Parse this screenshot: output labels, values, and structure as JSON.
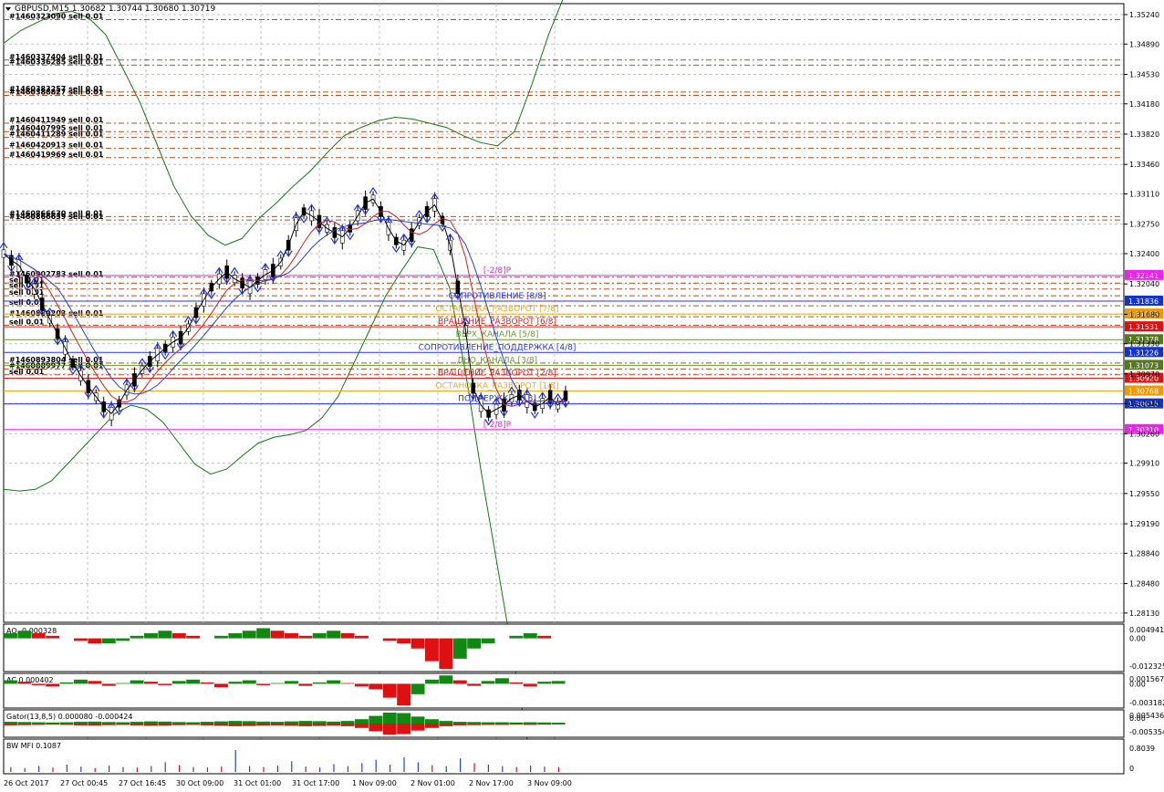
{
  "symbol_header": "GBPUSD,M15  1.30682 1.30744 1.30680 1.30719",
  "colors": {
    "background": "#ffffff",
    "grid": "#c0c0c0",
    "candle": "#000000",
    "envelope": "#117711",
    "arrows": "#2233ee",
    "order_line": "#b05020",
    "bullish": "#118811",
    "bearish": "#dd1111"
  },
  "chart_data": {
    "type": "candlestick",
    "price_ticks": [
      "1.35240",
      "1.34890",
      "1.34530",
      "1.34180",
      "1.33820",
      "1.33460",
      "1.33110",
      "1.32750",
      "1.32400",
      "1.32040",
      "1.31680",
      "1.31330",
      "1.30970",
      "1.30620",
      "1.30260",
      "1.29910",
      "1.29550",
      "1.29190",
      "1.28840",
      "1.28480",
      "1.28130"
    ],
    "time_ticks": [
      "26 Oct 2017",
      "27 Oct 00:45",
      "27 Oct 16:45",
      "30 Oct 09:00",
      "31 Oct 01:00",
      "31 Oct 17:00",
      "1 Nov 09:00",
      "2 Nov 01:00",
      "2 Nov 17:00",
      "3 Nov 09:00"
    ],
    "price_series": [
      1.324,
      1.3232,
      1.3226,
      1.321,
      1.3198,
      1.318,
      1.3162,
      1.3145,
      1.3128,
      1.311,
      1.3095,
      1.3082,
      1.307,
      1.3058,
      1.305,
      1.3062,
      1.3078,
      1.309,
      1.3102,
      1.3112,
      1.312,
      1.3128,
      1.3135,
      1.314,
      1.3152,
      1.317,
      1.3185,
      1.32,
      1.321,
      1.3218,
      1.321,
      1.3205,
      1.32,
      1.3208,
      1.3215,
      1.322,
      1.323,
      1.325,
      1.3275,
      1.329,
      1.3285,
      1.3278,
      1.327,
      1.3265,
      1.326,
      1.327,
      1.3285,
      1.33,
      1.3305,
      1.329,
      1.327,
      1.3255,
      1.325,
      1.3262,
      1.3278,
      1.329,
      1.3298,
      1.328,
      1.325,
      1.32,
      1.315,
      1.308,
      1.306,
      1.305,
      1.3055,
      1.306,
      1.3068,
      1.3072,
      1.3065,
      1.3058,
      1.3062,
      1.307,
      1.306,
      1.3071
    ],
    "envelope_upper": [
      1.349,
      1.3505,
      1.3515,
      1.3525,
      1.3528,
      1.352,
      1.35,
      1.346,
      1.342,
      1.337,
      1.332,
      1.3285,
      1.3262,
      1.325,
      1.3258,
      1.3282,
      1.33,
      1.332,
      1.3338,
      1.336,
      1.338,
      1.339,
      1.3398,
      1.3402,
      1.34,
      1.3395,
      1.339,
      1.338,
      1.3372,
      1.3368,
      1.3385,
      1.344,
      1.35,
      1.355
    ],
    "envelope_lower": [
      1.296,
      1.2958,
      1.296,
      1.297,
      1.299,
      1.301,
      1.303,
      1.305,
      1.306,
      1.3055,
      1.304,
      1.3015,
      1.299,
      1.2978,
      1.2984,
      1.3,
      1.3015,
      1.3022,
      1.3025,
      1.303,
      1.3045,
      1.307,
      1.311,
      1.315,
      1.319,
      1.322,
      1.3248,
      1.3245,
      1.32,
      1.31,
      1.298,
      1.287,
      1.276,
      1.265
    ],
    "murrey_lines": [
      {
        "price": 1.32141,
        "label": "[-2/8]P",
        "tag": "1.32141",
        "color": "#ee22ee",
        "tag_color": "#ee22ee"
      },
      {
        "price": 1.31836,
        "label": "СОПРОТИВЛЕНИЕ [8/8]",
        "tag": "1.31836",
        "color": "#2233ee",
        "tag_color": "#1133cc"
      },
      {
        "price": 1.31683,
        "label": "ОСТАНОВКА_РАЗВОРОТ [7/8]",
        "tag": "1.31683",
        "color": "#eeaa22",
        "tag_color": "#ee9900"
      },
      {
        "price": 1.31531,
        "label": "ВРАЩЕНИЕ_РАЗВОРОТ [6/8]",
        "tag": "1.31531",
        "color": "#dd2222",
        "tag_color": "#dd1111"
      },
      {
        "price": 1.31378,
        "label": "ВЕРХ_КАНАЛА [5/8]",
        "tag": "1.31378",
        "color": "#669933",
        "tag_color": "#557722"
      },
      {
        "price": 1.31226,
        "label": "СОПРОТИВЛЕНИЕ_ПОДДЕРЖКА [4/8]",
        "tag": "1.31226",
        "color": "#2233ee",
        "tag_color": "#1133cc"
      },
      {
        "price": 1.31073,
        "label": "ДНО_КАНАЛА [3/8]",
        "tag": "1.31073",
        "color": "#669933",
        "tag_color": "#557722"
      },
      {
        "price": 1.3092,
        "label": "ВРАЩЕНИЕ_РАЗВОРОТ [2/8]",
        "tag": "1.30920",
        "color": "#dd2222",
        "tag_color": "#dd1111"
      },
      {
        "price": 1.30768,
        "label": "ОСТАНОВКА_РАЗВОРОТ [1/8]",
        "tag": "1.30768",
        "color": "#eeaa22",
        "tag_color": "#ee9900"
      },
      {
        "price": 1.30615,
        "label": "ПОДДЕРЖКА [0/8]",
        "tag": "1.30615",
        "color": "#2233ee",
        "tag_color": "#1133cc"
      },
      {
        "price": 1.3031,
        "label": "[-2/8]P",
        "tag": "1.30310",
        "color": "#ee22ee",
        "tag_color": "#ee22ee"
      }
    ],
    "order_lines": [
      {
        "price": 1.3518,
        "label": "#1460323090 sell 0.01"
      },
      {
        "price": 1.347,
        "label": "#1460337404 sell 0.01"
      },
      {
        "price": 1.3464,
        "label": "#1460336285 sell 0.01"
      },
      {
        "price": 1.3432,
        "label": "#1460383257 sell 0.01"
      },
      {
        "price": 1.3428,
        "label": "#1460388827 sell 0.01"
      },
      {
        "price": 1.3395,
        "label": "#1460411949 sell 0.01"
      },
      {
        "price": 1.3385,
        "label": "#1460407995 sell 0.01"
      },
      {
        "price": 1.3378,
        "label": "#1460411289 sell 0.01"
      },
      {
        "price": 1.3365,
        "label": "#1460420913 sell 0.01"
      },
      {
        "price": 1.3354,
        "label": "#1460419969 sell 0.01"
      },
      {
        "price": 1.3284,
        "label": "#1460866630 sell 0.01"
      },
      {
        "price": 1.328,
        "label": "#1460866639 sell 0.01"
      },
      {
        "price": 1.3212,
        "label": "#1460902783 sell 0.01"
      },
      {
        "price": 1.3205,
        "label": "sell 0.01"
      },
      {
        "price": 1.3198,
        "label": "sell 0.01"
      },
      {
        "price": 1.319,
        "label": "sell 0.01"
      },
      {
        "price": 1.3178,
        "label": "sell 0.01"
      },
      {
        "price": 1.3165,
        "label": "#1460889203 sell 0.01"
      },
      {
        "price": 1.3155,
        "label": "sell 0.01"
      },
      {
        "price": 1.311,
        "label": "#1460893804 sell 0.01"
      },
      {
        "price": 1.3103,
        "label": "#1460889977 sell 0.01"
      },
      {
        "price": 1.3096,
        "label": "sell 0.01"
      }
    ],
    "indicators": [
      {
        "name": "AO",
        "label": "AO -0.000328",
        "ticks": [
          "0.004941",
          "0.00",
          "-0.012325"
        ],
        "type": "histogram",
        "values": [
          0.002,
          0.003,
          0.002,
          0.001,
          0.0,
          -0.001,
          -0.002,
          -0.002,
          -0.001,
          0.001,
          0.002,
          0.003,
          0.002,
          0.001,
          0.0,
          0.001,
          0.002,
          0.003,
          0.004,
          0.003,
          0.002,
          0.001,
          0.002,
          0.003,
          0.002,
          0.001,
          0.0,
          -0.001,
          -0.002,
          -0.004,
          -0.009,
          -0.012,
          -0.008,
          -0.004,
          -0.002,
          0.0,
          0.001,
          0.002,
          0.001,
          0.0
        ]
      },
      {
        "name": "AC",
        "label": "AC 0.000402",
        "ticks": [
          "0.001567",
          "0.00",
          "-0.003182"
        ],
        "type": "histogram",
        "values": [
          0.0005,
          0.0003,
          -0.0002,
          -0.0004,
          0.0002,
          0.0006,
          0.0004,
          -0.0003,
          0.0001,
          0.0005,
          0.0003,
          -0.0002,
          0.0004,
          0.0006,
          0.0002,
          -0.0005,
          0.0003,
          0.0005,
          -0.0002,
          0.0001,
          0.0004,
          -0.0003,
          0.0002,
          0.0005,
          0.0001,
          -0.0004,
          -0.0008,
          -0.002,
          -0.0031,
          -0.0015,
          0.0006,
          0.0012,
          0.0005,
          -0.0003,
          0.0004,
          0.0008,
          0.0002,
          -0.0004,
          0.0003,
          0.0004
        ]
      },
      {
        "name": "Gator",
        "label": "Gator(13,8,5) 0.000080 -0.000424",
        "ticks": [
          "0.005436",
          "0.00",
          "-0.005354"
        ],
        "type": "mirror",
        "values": [
          0.0008,
          0.0007,
          0.0006,
          0.0005,
          0.0006,
          0.0008,
          0.0009,
          0.0007,
          0.0006,
          0.0008,
          0.001,
          0.0009,
          0.0007,
          0.0006,
          0.0008,
          0.001,
          0.0012,
          0.0011,
          0.0009,
          0.0008,
          0.001,
          0.0012,
          0.0011,
          0.0009,
          0.0012,
          0.002,
          0.0035,
          0.005,
          0.0048,
          0.0032,
          0.002,
          0.0012,
          0.0008,
          0.0007,
          0.0006,
          0.0006,
          0.0005,
          0.0006,
          0.0005,
          0.0004
        ]
      },
      {
        "name": "BW MFI",
        "label": "BW MFI 0.1087",
        "ticks": [
          "0.8039",
          "0"
        ],
        "type": "bars",
        "values": [
          0.1,
          0.08,
          0.12,
          0.09,
          0.15,
          0.11,
          0.08,
          0.13,
          0.1,
          0.09,
          0.12,
          0.2,
          0.14,
          0.1,
          0.09,
          0.11,
          0.45,
          0.12,
          0.1,
          0.13,
          0.22,
          0.11,
          0.09,
          0.16,
          0.12,
          0.18,
          0.25,
          0.15,
          0.3,
          0.2,
          0.14,
          0.12,
          0.28,
          0.18,
          0.15,
          0.12,
          0.1,
          0.13,
          0.11,
          0.1
        ]
      }
    ]
  }
}
